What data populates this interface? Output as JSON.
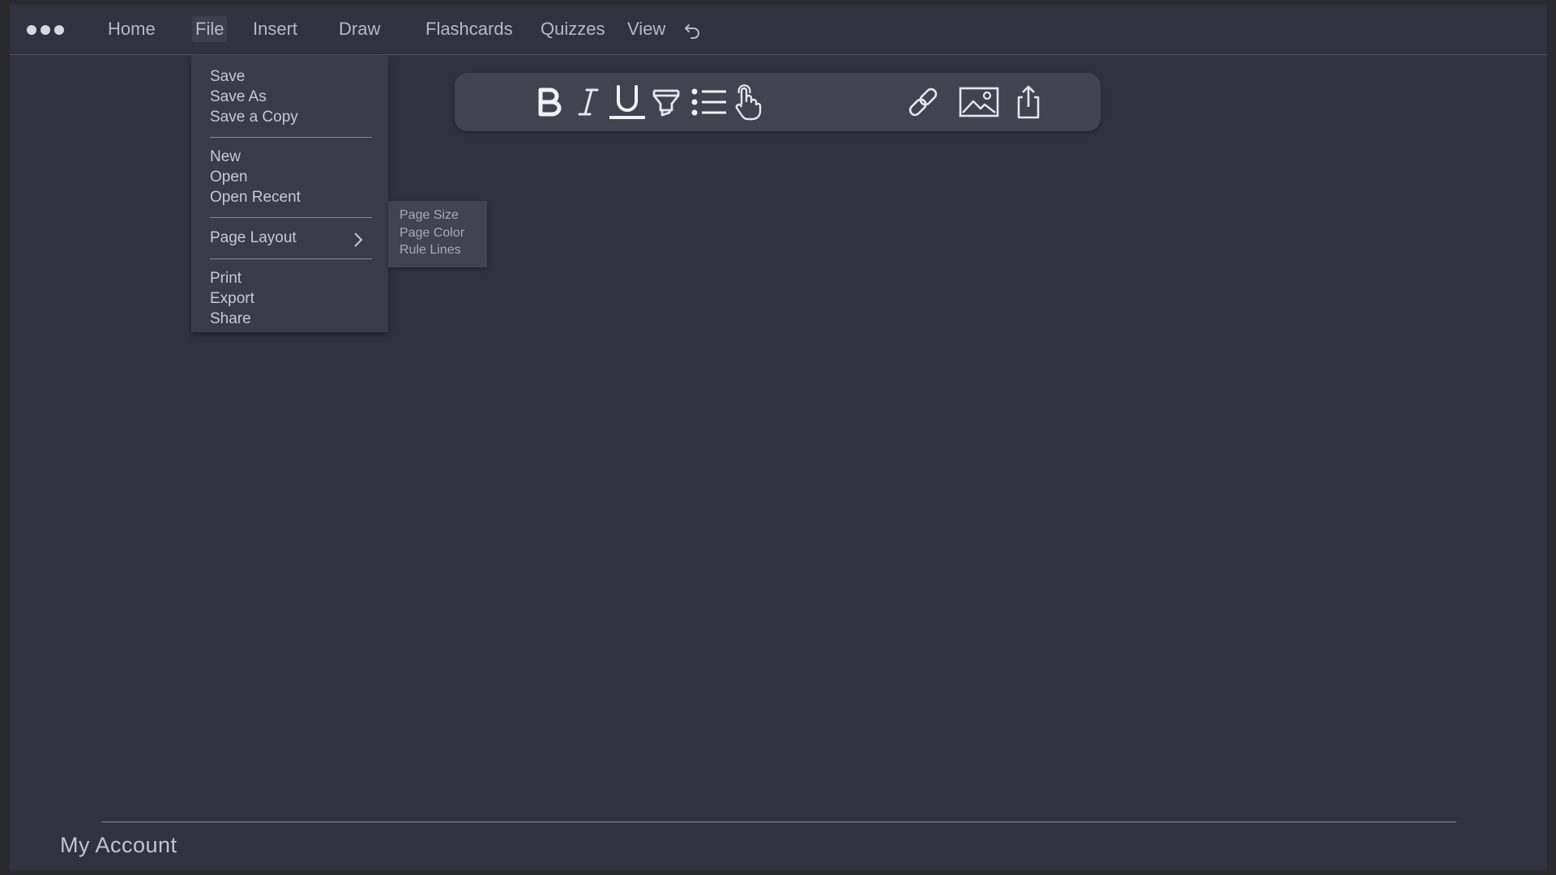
{
  "menubar": {
    "items": [
      {
        "label": "Home"
      },
      {
        "label": "File"
      },
      {
        "label": "Insert"
      },
      {
        "label": "Draw"
      },
      {
        "label": "Flashcards"
      },
      {
        "label": "Quizzes"
      },
      {
        "label": "View"
      }
    ],
    "active": "File",
    "icons": [
      "more-dots-icon",
      "undo-icon"
    ]
  },
  "toolbar": {
    "buttons": [
      "bold-icon",
      "italic-icon",
      "underline-icon",
      "highlighter-icon",
      "bullet-list-icon",
      "touch-icon",
      "link-icon",
      "image-icon",
      "share-icon"
    ]
  },
  "file_menu": {
    "groups": [
      [
        "Save",
        "Save As",
        "Save a Copy"
      ],
      [
        "New",
        "Open",
        "Open Recent"
      ],
      [
        "Page Layout"
      ],
      [
        "Print",
        "Export",
        "Share"
      ]
    ]
  },
  "page_layout_submenu": {
    "items": [
      "Page Size",
      "Page Color",
      "Rule Lines"
    ]
  },
  "footer": {
    "account_label": "My Account"
  },
  "colors": {
    "background": "#32313f",
    "toolbar": "#43424f",
    "menu": "#3b3a48",
    "text": "#c8c8d2"
  }
}
